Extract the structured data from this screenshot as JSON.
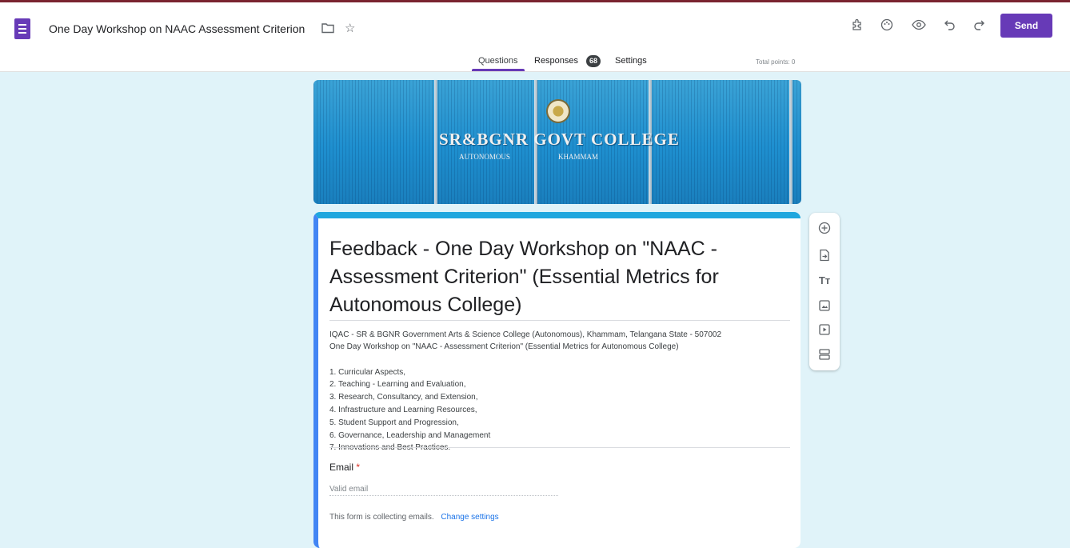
{
  "header": {
    "doc_title": "One Day Workshop on NAAC Assessment Criterion",
    "send_label": "Send",
    "icons": [
      "forms-app-icon",
      "folder-icon",
      "star-icon",
      "addon-icon",
      "palette-icon",
      "preview-eye-icon",
      "undo-icon",
      "redo-icon"
    ]
  },
  "tabs": {
    "questions": "Questions",
    "responses": "Responses",
    "responses_count": "68",
    "settings": "Settings"
  },
  "total_points": "Total points: 0",
  "banner": {
    "college_name": "SR&BGNR GOVT COLLEGE",
    "sub_left": "AUTONOMOUS",
    "sub_right": "KHAMMAM"
  },
  "form": {
    "title": "Feedback - One Day Workshop on \"NAAC - Assessment Criterion\" (Essential Metrics for Autonomous College)",
    "description_line1": "IQAC - SR & BGNR Government Arts & Science College (Autonomous), Khammam, Telangana State - 507002",
    "description_line2": "One Day Workshop on \"NAAC - Assessment Criterion\" (Essential Metrics for Autonomous College)",
    "criteria": [
      "1. Curricular Aspects,",
      "2. Teaching - Learning and Evaluation,",
      "3. Research, Consultancy, and Extension,",
      "4. Infrastructure and Learning Resources,",
      "5. Student Support and Progression,",
      "6. Governance, Leadership and Management",
      "7. Innovations and Best Practices."
    ],
    "email_label": "Email",
    "required_mark": "*",
    "email_placeholder": "Valid email",
    "collect_note": "This form is collecting emails.",
    "change_settings": "Change settings"
  },
  "side_toolbar": [
    "add-question-icon",
    "import-questions-icon",
    "add-title-icon",
    "add-image-icon",
    "add-video-icon",
    "add-section-icon"
  ],
  "colors": {
    "accent": "#673ab7",
    "banner": "#1e8fcf",
    "card_top": "#1fa7de",
    "background": "#e0f3f9"
  }
}
